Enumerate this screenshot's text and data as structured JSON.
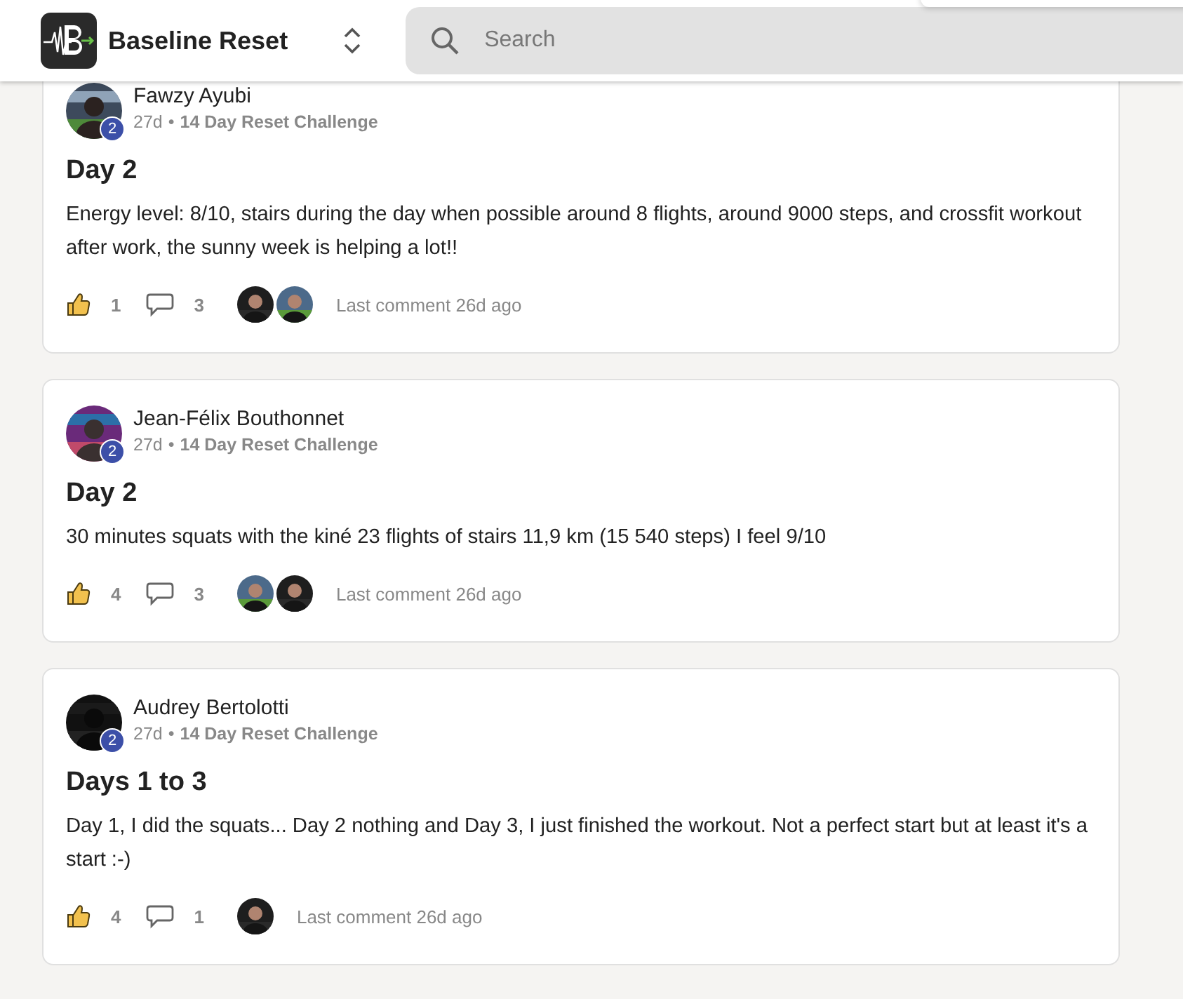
{
  "header": {
    "app_name": "Baseline Reset",
    "search": {
      "placeholder": "Search"
    }
  },
  "posts": [
    {
      "author": "Fawzy Ayubi",
      "badge": "2",
      "age": "27d",
      "separator": "•",
      "group": "14 Day Reset Challenge",
      "title": "Day 2",
      "body": "Energy level: 8/10, stairs during the day when possible around 8 flights, around 9000 steps, and crossfit workout after work, the sunny week is helping a lot!!",
      "likes": "1",
      "comments": "3",
      "last_comment": "Last comment 26d ago"
    },
    {
      "author": "Jean-Félix Bouthonnet",
      "badge": "2",
      "age": "27d",
      "separator": "•",
      "group": "14 Day Reset Challenge",
      "title": "Day 2",
      "body": "30 minutes squats with the kiné 23 flights of stairs 11,9 km (15 540 steps) I feel 9/10",
      "likes": "4",
      "comments": "3",
      "last_comment": "Last comment 26d ago"
    },
    {
      "author": "Audrey Bertolotti",
      "badge": "2",
      "age": "27d",
      "separator": "•",
      "group": "14 Day Reset Challenge",
      "title": "Days 1 to 3",
      "body": "Day 1, I did the squats... Day 2 nothing and Day 3, I just finished the workout. Not a perfect start but at least it's a start :-)",
      "likes": "4",
      "comments": "1",
      "last_comment": "Last comment 26d ago"
    }
  ]
}
